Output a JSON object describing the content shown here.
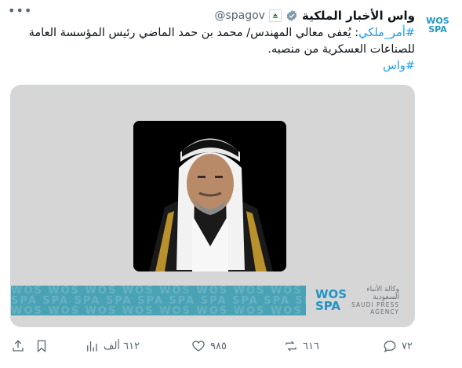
{
  "account": {
    "display_name": "واس الأخبار الملكية",
    "handle": "@spagov",
    "avatar_text_top": "WOS",
    "avatar_text_bottom": "SPA"
  },
  "tweet": {
    "hashtag_1": "#أمر_ملكي",
    "text_line_1": ": يُعفى معالي المهندس/ محمد بن حمد الماضي رئيس المؤسسة العامة",
    "text_line_2": "للصناعات العسكرية من منصبه.",
    "hashtag_2": "#واس"
  },
  "media": {
    "logo_arabic_1": "وكالة الأنباء",
    "logo_arabic_2": "السعودية",
    "logo_english_1": "SAUDI PRESS",
    "logo_english_2": "AGENCY",
    "logo_mark_top": "WOS",
    "logo_mark_bottom": "SPA"
  },
  "actions": {
    "replies": "٧٢",
    "retweets": "٦١٦",
    "likes": "٩٨٥",
    "views": "٦١٢ ألف"
  },
  "more_label": "•••"
}
